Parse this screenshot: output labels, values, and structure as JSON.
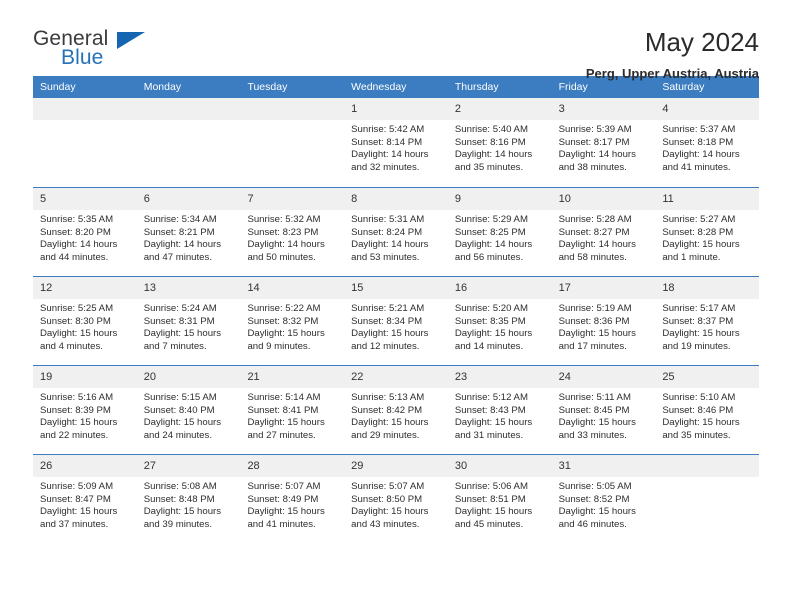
{
  "brand": {
    "name_part1": "General",
    "name_part2": "Blue",
    "accent_color": "#2572b8",
    "triangle_color": "#1565b0"
  },
  "header": {
    "title": "May 2024",
    "location": "Perg, Upper Austria, Austria",
    "header_bg": "#3c7cc0",
    "day_band_bg": "#f0f0f0"
  },
  "weekdays": [
    "Sunday",
    "Monday",
    "Tuesday",
    "Wednesday",
    "Thursday",
    "Friday",
    "Saturday"
  ],
  "labels": {
    "sunrise_prefix": "Sunrise:",
    "sunset_prefix": "Sunset:",
    "daylight_prefix": "Daylight:"
  },
  "weeks": [
    [
      {
        "day": "",
        "empty": true
      },
      {
        "day": "",
        "empty": true
      },
      {
        "day": "",
        "empty": true
      },
      {
        "day": "1",
        "sunrise": "Sunrise: 5:42 AM",
        "sunset": "Sunset: 8:14 PM",
        "daylight_l1": "Daylight: 14 hours",
        "daylight_l2": "and 32 minutes."
      },
      {
        "day": "2",
        "sunrise": "Sunrise: 5:40 AM",
        "sunset": "Sunset: 8:16 PM",
        "daylight_l1": "Daylight: 14 hours",
        "daylight_l2": "and 35 minutes."
      },
      {
        "day": "3",
        "sunrise": "Sunrise: 5:39 AM",
        "sunset": "Sunset: 8:17 PM",
        "daylight_l1": "Daylight: 14 hours",
        "daylight_l2": "and 38 minutes."
      },
      {
        "day": "4",
        "sunrise": "Sunrise: 5:37 AM",
        "sunset": "Sunset: 8:18 PM",
        "daylight_l1": "Daylight: 14 hours",
        "daylight_l2": "and 41 minutes."
      }
    ],
    [
      {
        "day": "5",
        "sunrise": "Sunrise: 5:35 AM",
        "sunset": "Sunset: 8:20 PM",
        "daylight_l1": "Daylight: 14 hours",
        "daylight_l2": "and 44 minutes."
      },
      {
        "day": "6",
        "sunrise": "Sunrise: 5:34 AM",
        "sunset": "Sunset: 8:21 PM",
        "daylight_l1": "Daylight: 14 hours",
        "daylight_l2": "and 47 minutes."
      },
      {
        "day": "7",
        "sunrise": "Sunrise: 5:32 AM",
        "sunset": "Sunset: 8:23 PM",
        "daylight_l1": "Daylight: 14 hours",
        "daylight_l2": "and 50 minutes."
      },
      {
        "day": "8",
        "sunrise": "Sunrise: 5:31 AM",
        "sunset": "Sunset: 8:24 PM",
        "daylight_l1": "Daylight: 14 hours",
        "daylight_l2": "and 53 minutes."
      },
      {
        "day": "9",
        "sunrise": "Sunrise: 5:29 AM",
        "sunset": "Sunset: 8:25 PM",
        "daylight_l1": "Daylight: 14 hours",
        "daylight_l2": "and 56 minutes."
      },
      {
        "day": "10",
        "sunrise": "Sunrise: 5:28 AM",
        "sunset": "Sunset: 8:27 PM",
        "daylight_l1": "Daylight: 14 hours",
        "daylight_l2": "and 58 minutes."
      },
      {
        "day": "11",
        "sunrise": "Sunrise: 5:27 AM",
        "sunset": "Sunset: 8:28 PM",
        "daylight_l1": "Daylight: 15 hours",
        "daylight_l2": "and 1 minute."
      }
    ],
    [
      {
        "day": "12",
        "sunrise": "Sunrise: 5:25 AM",
        "sunset": "Sunset: 8:30 PM",
        "daylight_l1": "Daylight: 15 hours",
        "daylight_l2": "and 4 minutes."
      },
      {
        "day": "13",
        "sunrise": "Sunrise: 5:24 AM",
        "sunset": "Sunset: 8:31 PM",
        "daylight_l1": "Daylight: 15 hours",
        "daylight_l2": "and 7 minutes."
      },
      {
        "day": "14",
        "sunrise": "Sunrise: 5:22 AM",
        "sunset": "Sunset: 8:32 PM",
        "daylight_l1": "Daylight: 15 hours",
        "daylight_l2": "and 9 minutes."
      },
      {
        "day": "15",
        "sunrise": "Sunrise: 5:21 AM",
        "sunset": "Sunset: 8:34 PM",
        "daylight_l1": "Daylight: 15 hours",
        "daylight_l2": "and 12 minutes."
      },
      {
        "day": "16",
        "sunrise": "Sunrise: 5:20 AM",
        "sunset": "Sunset: 8:35 PM",
        "daylight_l1": "Daylight: 15 hours",
        "daylight_l2": "and 14 minutes."
      },
      {
        "day": "17",
        "sunrise": "Sunrise: 5:19 AM",
        "sunset": "Sunset: 8:36 PM",
        "daylight_l1": "Daylight: 15 hours",
        "daylight_l2": "and 17 minutes."
      },
      {
        "day": "18",
        "sunrise": "Sunrise: 5:17 AM",
        "sunset": "Sunset: 8:37 PM",
        "daylight_l1": "Daylight: 15 hours",
        "daylight_l2": "and 19 minutes."
      }
    ],
    [
      {
        "day": "19",
        "sunrise": "Sunrise: 5:16 AM",
        "sunset": "Sunset: 8:39 PM",
        "daylight_l1": "Daylight: 15 hours",
        "daylight_l2": "and 22 minutes."
      },
      {
        "day": "20",
        "sunrise": "Sunrise: 5:15 AM",
        "sunset": "Sunset: 8:40 PM",
        "daylight_l1": "Daylight: 15 hours",
        "daylight_l2": "and 24 minutes."
      },
      {
        "day": "21",
        "sunrise": "Sunrise: 5:14 AM",
        "sunset": "Sunset: 8:41 PM",
        "daylight_l1": "Daylight: 15 hours",
        "daylight_l2": "and 27 minutes."
      },
      {
        "day": "22",
        "sunrise": "Sunrise: 5:13 AM",
        "sunset": "Sunset: 8:42 PM",
        "daylight_l1": "Daylight: 15 hours",
        "daylight_l2": "and 29 minutes."
      },
      {
        "day": "23",
        "sunrise": "Sunrise: 5:12 AM",
        "sunset": "Sunset: 8:43 PM",
        "daylight_l1": "Daylight: 15 hours",
        "daylight_l2": "and 31 minutes."
      },
      {
        "day": "24",
        "sunrise": "Sunrise: 5:11 AM",
        "sunset": "Sunset: 8:45 PM",
        "daylight_l1": "Daylight: 15 hours",
        "daylight_l2": "and 33 minutes."
      },
      {
        "day": "25",
        "sunrise": "Sunrise: 5:10 AM",
        "sunset": "Sunset: 8:46 PM",
        "daylight_l1": "Daylight: 15 hours",
        "daylight_l2": "and 35 minutes."
      }
    ],
    [
      {
        "day": "26",
        "sunrise": "Sunrise: 5:09 AM",
        "sunset": "Sunset: 8:47 PM",
        "daylight_l1": "Daylight: 15 hours",
        "daylight_l2": "and 37 minutes."
      },
      {
        "day": "27",
        "sunrise": "Sunrise: 5:08 AM",
        "sunset": "Sunset: 8:48 PM",
        "daylight_l1": "Daylight: 15 hours",
        "daylight_l2": "and 39 minutes."
      },
      {
        "day": "28",
        "sunrise": "Sunrise: 5:07 AM",
        "sunset": "Sunset: 8:49 PM",
        "daylight_l1": "Daylight: 15 hours",
        "daylight_l2": "and 41 minutes."
      },
      {
        "day": "29",
        "sunrise": "Sunrise: 5:07 AM",
        "sunset": "Sunset: 8:50 PM",
        "daylight_l1": "Daylight: 15 hours",
        "daylight_l2": "and 43 minutes."
      },
      {
        "day": "30",
        "sunrise": "Sunrise: 5:06 AM",
        "sunset": "Sunset: 8:51 PM",
        "daylight_l1": "Daylight: 15 hours",
        "daylight_l2": "and 45 minutes."
      },
      {
        "day": "31",
        "sunrise": "Sunrise: 5:05 AM",
        "sunset": "Sunset: 8:52 PM",
        "daylight_l1": "Daylight: 15 hours",
        "daylight_l2": "and 46 minutes."
      },
      {
        "day": "",
        "empty": true
      }
    ]
  ]
}
